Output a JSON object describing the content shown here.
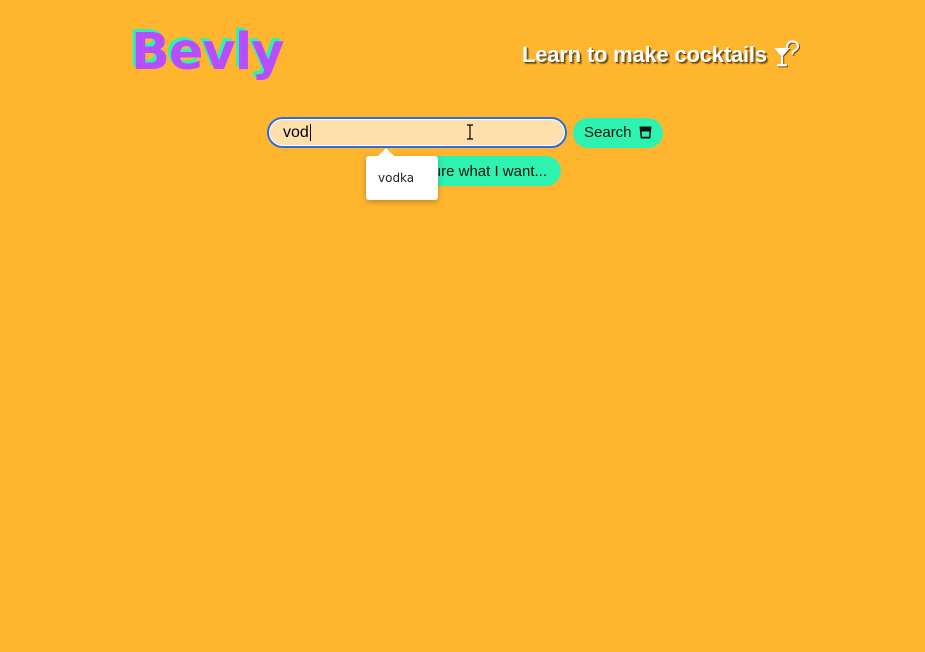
{
  "header": {
    "logo_text": "Bevly",
    "tagline": "Learn to make cocktails",
    "tagline_icon": "cocktail-question-icon"
  },
  "search": {
    "value": "vod",
    "button_label": "Search",
    "button_icon": "glass-icon"
  },
  "unsure_button": {
    "label": "ure what I want..."
  },
  "autocomplete": {
    "suggestions": [
      "vodka"
    ]
  },
  "colors": {
    "background": "#FFB52E",
    "accent": "#2EF2B0",
    "logo": "#B84DFF",
    "input_background": "#FFE0AC",
    "focus_ring": "#2F6DDB"
  }
}
